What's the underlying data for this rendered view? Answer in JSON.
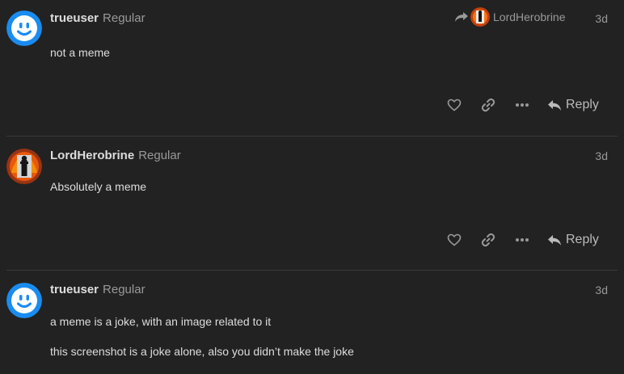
{
  "posts": [
    {
      "username": "trueuser",
      "user_title": "Regular",
      "date": "3d",
      "reply_to": "LordHerobrine",
      "paragraphs": [
        "not a meme"
      ],
      "reply_label": "Reply"
    },
    {
      "username": "LordHerobrine",
      "user_title": "Regular",
      "date": "3d",
      "paragraphs": [
        "Absolutely a meme"
      ],
      "reply_label": "Reply"
    },
    {
      "username": "trueuser",
      "user_title": "Regular",
      "date": "3d",
      "paragraphs": [
        "a meme is a joke, with an image related to it",
        "this screenshot is a joke alone, also you didn’t make the joke"
      ]
    }
  ],
  "icons": {
    "like": "heart-icon",
    "link": "link-icon",
    "more": "ellipsis-icon",
    "reply": "reply-arrow-icon",
    "reply_to": "share-arrow-icon"
  },
  "colors": {
    "background": "#222222",
    "trueuser_avatar": "#1a8cf0",
    "text": "#dddddd",
    "muted": "#999999"
  }
}
